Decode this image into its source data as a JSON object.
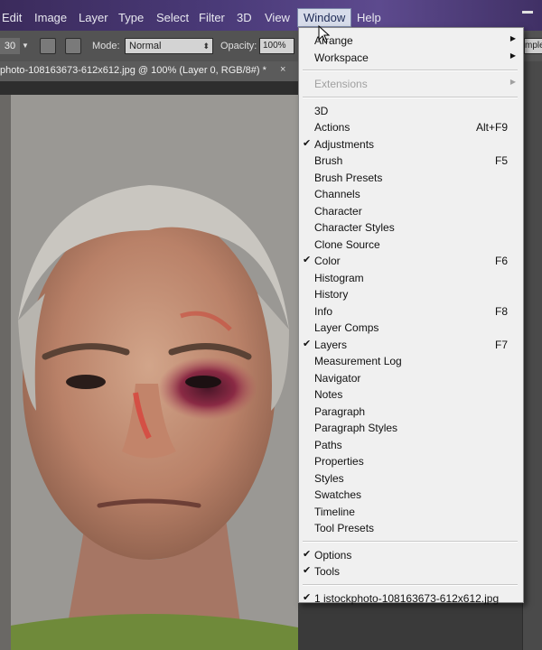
{
  "menubar": {
    "items": [
      "Edit",
      "Image",
      "Layer",
      "Type",
      "Select",
      "Filter",
      "3D",
      "View",
      "Window",
      "Help"
    ],
    "active": "Window"
  },
  "options": {
    "size": "30",
    "mode_label": "Mode:",
    "mode_value": "Normal",
    "opacity_label": "Opacity:",
    "opacity_value": "100%",
    "right_field": "mple"
  },
  "document": {
    "tab_title": "photo-108163673-612x612.jpg @ 100% (Layer 0, RGB/8#) *",
    "close": "×"
  },
  "window_menu": {
    "top": [
      {
        "label": "Arrange",
        "submenu": true
      },
      {
        "label": "Workspace",
        "submenu": true
      }
    ],
    "extensions": {
      "label": "Extensions",
      "submenu": true,
      "disabled": true
    },
    "panels": [
      {
        "label": "3D"
      },
      {
        "label": "Actions",
        "shortcut": "Alt+F9"
      },
      {
        "label": "Adjustments",
        "checked": true
      },
      {
        "label": "Brush",
        "shortcut": "F5"
      },
      {
        "label": "Brush Presets"
      },
      {
        "label": "Channels"
      },
      {
        "label": "Character"
      },
      {
        "label": "Character Styles"
      },
      {
        "label": "Clone Source"
      },
      {
        "label": "Color",
        "shortcut": "F6",
        "checked": true
      },
      {
        "label": "Histogram"
      },
      {
        "label": "History"
      },
      {
        "label": "Info",
        "shortcut": "F8"
      },
      {
        "label": "Layer Comps"
      },
      {
        "label": "Layers",
        "shortcut": "F7",
        "checked": true
      },
      {
        "label": "Measurement Log"
      },
      {
        "label": "Navigator"
      },
      {
        "label": "Notes"
      },
      {
        "label": "Paragraph"
      },
      {
        "label": "Paragraph Styles"
      },
      {
        "label": "Paths"
      },
      {
        "label": "Properties"
      },
      {
        "label": "Styles"
      },
      {
        "label": "Swatches"
      },
      {
        "label": "Timeline"
      },
      {
        "label": "Tool Presets"
      }
    ],
    "bottom": [
      {
        "label": "Options",
        "checked": true
      },
      {
        "label": "Tools",
        "checked": true
      }
    ],
    "files": [
      {
        "label": "1 istockphoto-108163673-612x612.jpg",
        "checked": true
      }
    ]
  },
  "check_glyph": "✔",
  "submenu_glyph": "▶"
}
